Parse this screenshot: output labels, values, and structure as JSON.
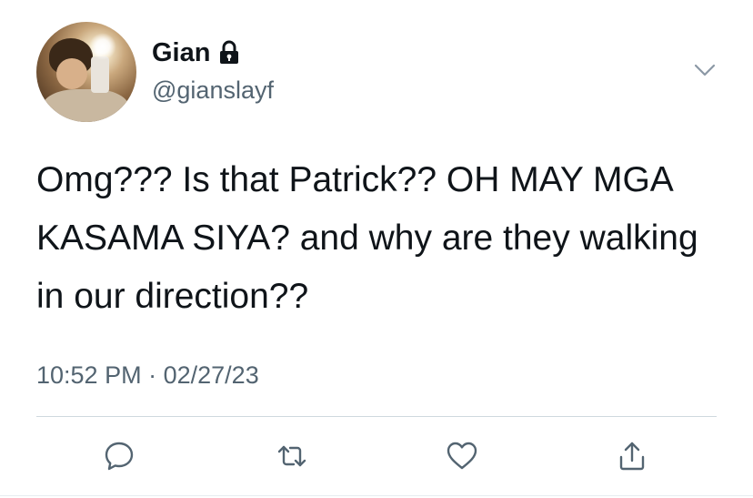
{
  "author": {
    "display_name": "Gian",
    "handle": "@gianslayf",
    "protected_icon": "lock-icon",
    "avatar_icon": "profile-photo"
  },
  "tweet": {
    "text": "Omg??? Is that Patrick?? OH MAY MGA KASAMA SIYA? and why are they walking in our direction??",
    "time": "10:52 PM",
    "separator": "·",
    "date": "02/27/23"
  },
  "menu": {
    "icon": "chevron-down-icon"
  },
  "actions": [
    {
      "name": "reply",
      "icon": "reply-icon"
    },
    {
      "name": "retweet",
      "icon": "retweet-icon"
    },
    {
      "name": "like",
      "icon": "heart-icon"
    },
    {
      "name": "share",
      "icon": "share-icon"
    }
  ],
  "colors": {
    "primary_text": "#0f1419",
    "secondary_text": "#536471",
    "icon": "#536471",
    "divider": "#cfd9de",
    "background": "#ffffff"
  }
}
